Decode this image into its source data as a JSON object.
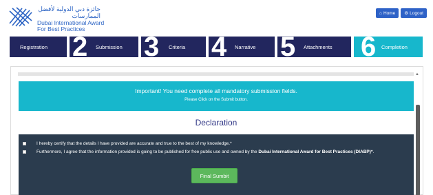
{
  "header": {
    "brand_arabic": "جائزة دبي الدولية لأفضل الممارسات",
    "brand_line1": "Dubai International Award",
    "brand_line2": "For Best Practices",
    "home_label": "Home",
    "logout_label": "Logout"
  },
  "steps": [
    {
      "number": "",
      "label": "Registration"
    },
    {
      "number": "2",
      "label": "Submission"
    },
    {
      "number": "3",
      "label": "Criteria"
    },
    {
      "number": "4",
      "label": "Narrative"
    },
    {
      "number": "5",
      "label": "Attachments"
    },
    {
      "number": "6",
      "label": "Completion"
    }
  ],
  "alert": {
    "title": "Important! You need complete all mandatory submission fields.",
    "subtitle": "Please Click on the Submit button."
  },
  "declaration": {
    "title": "Declaration",
    "item1": "I hereby certify that the details I have provided are accurate and true to the best of my knowledge.*",
    "item2_prefix": "Furthermore, I agree that the information provided is going to be published for free public use and owned by the ",
    "item2_bold": "Dubai International Award for Best Practices (DIABP)*",
    "item2_suffix": ".",
    "button_label": "Final Sumbit"
  },
  "colors": {
    "navy": "#22265e",
    "teal": "#17b7cc",
    "dark_panel": "#2b3c4e",
    "green": "#5cb85c",
    "blue": "#2e62c7"
  }
}
